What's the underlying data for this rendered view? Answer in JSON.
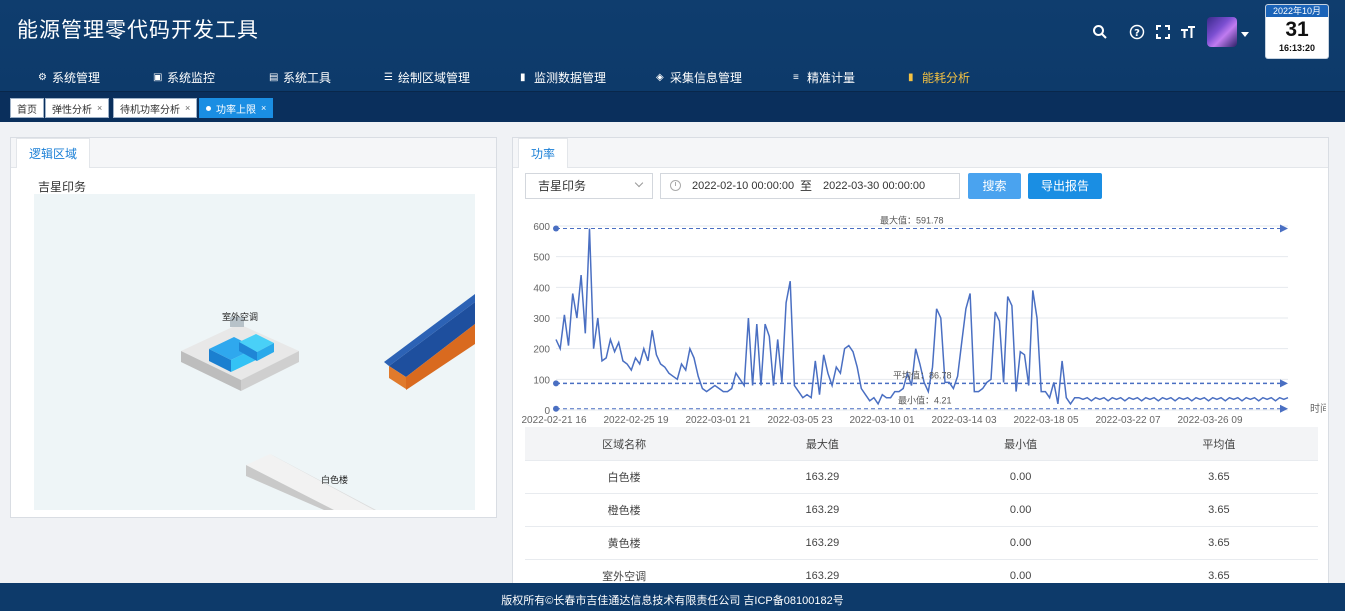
{
  "header": {
    "title": "能源管理零代码开发工具",
    "icons": [
      "search-icon",
      "help-icon",
      "fullscreen-icon",
      "font-size-icon"
    ],
    "calendar": {
      "month": "2022年10月",
      "day": "31",
      "time": "16:13:20"
    }
  },
  "nav": {
    "items": [
      {
        "label": "系统管理",
        "icon": "⚙"
      },
      {
        "label": "系统监控",
        "icon": "▣"
      },
      {
        "label": "系统工具",
        "icon": "▤"
      },
      {
        "label": "绘制区域管理",
        "icon": "☰"
      },
      {
        "label": "监测数据管理",
        "icon": "▮"
      },
      {
        "label": "采集信息管理",
        "icon": "◈"
      },
      {
        "label": "精准计量",
        "icon": "≡"
      },
      {
        "label": "能耗分析",
        "icon": "▮"
      }
    ]
  },
  "tabs": [
    {
      "label": "首页"
    },
    {
      "label": "弹性分析",
      "close": "×"
    },
    {
      "label": "待机功率分析",
      "close": "×"
    },
    {
      "label": "功率上限",
      "close": "×"
    }
  ],
  "left": {
    "tab": "逻辑区域",
    "area": "吉星印务",
    "labels": {
      "outdoor_ac": "室外空调",
      "white_building": "白色楼"
    }
  },
  "right": {
    "tab": "功率",
    "select_value": "吉星印务",
    "date_start": "2022-02-10 00:00:00",
    "date_sep": "至",
    "date_end": "2022-03-30 00:00:00",
    "search_label": "搜索",
    "export_label": "导出报告"
  },
  "chart_data": {
    "type": "line",
    "xlabel": "时间",
    "ylabel": "",
    "ylim": [
      0,
      600
    ],
    "yticks": [
      0,
      100,
      200,
      300,
      400,
      500,
      600
    ],
    "xticks": [
      "2022-02-21 16",
      "2022-02-25 19",
      "2022-03-01 21",
      "2022-03-05 23",
      "2022-03-10 01",
      "2022-03-14 03",
      "2022-03-18 05",
      "2022-03-22 07",
      "2022-03-26 09"
    ],
    "markers": {
      "max": 591.78,
      "avg": 86.78,
      "min": 4.21
    },
    "marker_labels": {
      "max": "最大值：591.78",
      "avg": "平均值：86.78",
      "min": "最小值：4.21"
    },
    "series": [
      {
        "values": [
          230,
          200,
          310,
          210,
          380,
          300,
          440,
          250,
          591.78,
          200,
          300,
          160,
          170,
          230,
          190,
          220,
          160,
          150,
          130,
          170,
          150,
          200,
          160,
          260,
          180,
          150,
          140,
          120,
          110,
          100,
          150,
          130,
          200,
          170,
          110,
          70,
          60,
          70,
          80,
          70,
          60,
          60,
          70,
          120,
          100,
          80,
          300,
          80,
          280,
          80,
          280,
          240,
          80,
          230,
          90,
          350,
          420,
          80,
          60,
          40,
          50,
          40,
          160,
          50,
          180,
          120,
          80,
          140,
          120,
          200,
          210,
          190,
          140,
          70,
          50,
          30,
          40,
          20,
          50,
          40,
          40,
          60,
          60,
          70,
          120,
          80,
          200,
          150,
          90,
          60,
          140,
          330,
          300,
          90,
          90,
          70,
          110,
          220,
          330,
          380,
          60,
          60,
          70,
          90,
          100,
          320,
          290,
          90,
          370,
          340,
          60,
          190,
          180,
          80,
          390,
          300,
          60,
          60,
          40,
          90,
          20,
          160,
          40,
          20,
          40,
          40,
          35,
          40,
          30,
          40,
          35,
          40,
          30,
          40,
          35,
          40,
          30,
          40,
          35,
          40,
          30,
          40,
          35,
          40,
          30,
          40,
          35,
          40,
          30,
          40,
          35,
          40,
          30,
          40,
          35,
          40,
          30,
          40,
          35,
          40,
          30,
          40,
          35,
          40,
          30,
          40,
          35,
          40,
          30,
          40,
          35,
          40,
          30,
          40,
          35,
          40
        ]
      }
    ]
  },
  "table": {
    "headers": [
      "区域名称",
      "最大值",
      "最小值",
      "平均值"
    ],
    "rows": [
      [
        "白色楼",
        "163.29",
        "0.00",
        "3.65"
      ],
      [
        "橙色楼",
        "163.29",
        "0.00",
        "3.65"
      ],
      [
        "黄色楼",
        "163.29",
        "0.00",
        "3.65"
      ],
      [
        "室外空调",
        "163.29",
        "0.00",
        "3.65"
      ]
    ]
  },
  "footer": {
    "text": "版权所有©长春市吉佳通达信息技术有限责任公司 吉ICP备08100182号"
  },
  "colors": {
    "header_bg": "#0d3a6a",
    "accent": "#1a8ee3",
    "line": "#4a6fc2",
    "active_nav": "#f5c242"
  }
}
